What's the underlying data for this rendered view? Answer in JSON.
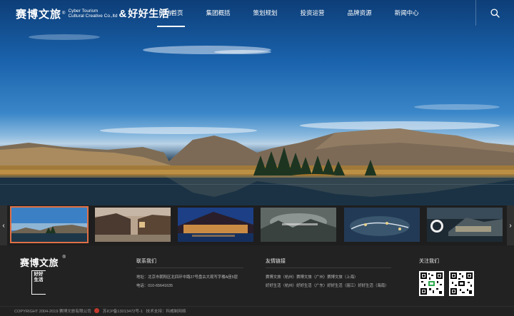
{
  "header": {
    "logo_cn": "赛博文旅",
    "logo_reg": "®",
    "logo_en_1": "Cyber Tourism",
    "logo_en_2": "Cultural Creative Co.,ltd",
    "logo_amp": "&",
    "logo_cn2": "好好生活",
    "logo_cn2_reg": "®",
    "nav": [
      {
        "label": "网站首页",
        "active": true
      },
      {
        "label": "集团概括",
        "active": false
      },
      {
        "label": "策划规划",
        "active": false
      },
      {
        "label": "投资运营",
        "active": false
      },
      {
        "label": "品牌资源",
        "active": false
      },
      {
        "label": "新闻中心",
        "active": false
      }
    ],
    "search_icon": "search-icon"
  },
  "carousel": {
    "prev_label": "‹",
    "next_label": "›",
    "thumbnails": [
      "lake-mountain",
      "old-street",
      "night-resort",
      "ink-landscape",
      "aerial-park",
      "modern-village"
    ]
  },
  "footer": {
    "logo_cn": "赛博文旅",
    "logo_reg": "®",
    "stamp_text": "好好生活",
    "contact": {
      "title": "联系我们",
      "address": "地址：北京市朝阳区北四环中路27号盘古大观写字楼A座5层",
      "phone": "电话：010-65641635"
    },
    "links": {
      "title": "友情链接",
      "row1": "赛博文旅（杭州）赛博文旅（广州）赛博文旅（上海）",
      "row2": "好好生活（杭州）好好生活（广东）好好生活（丽江）好好生活（海南）"
    },
    "follow": {
      "title": "关注我们"
    },
    "copyright": "COPYRIGHT 2004-2019 赛博文旅有限公司",
    "icp": "苏ICP备13013472号-1",
    "support": "技术支持：科威制网络"
  },
  "colors": {
    "active_thumb_border": "#e07046",
    "footer_bg": "#222222"
  }
}
